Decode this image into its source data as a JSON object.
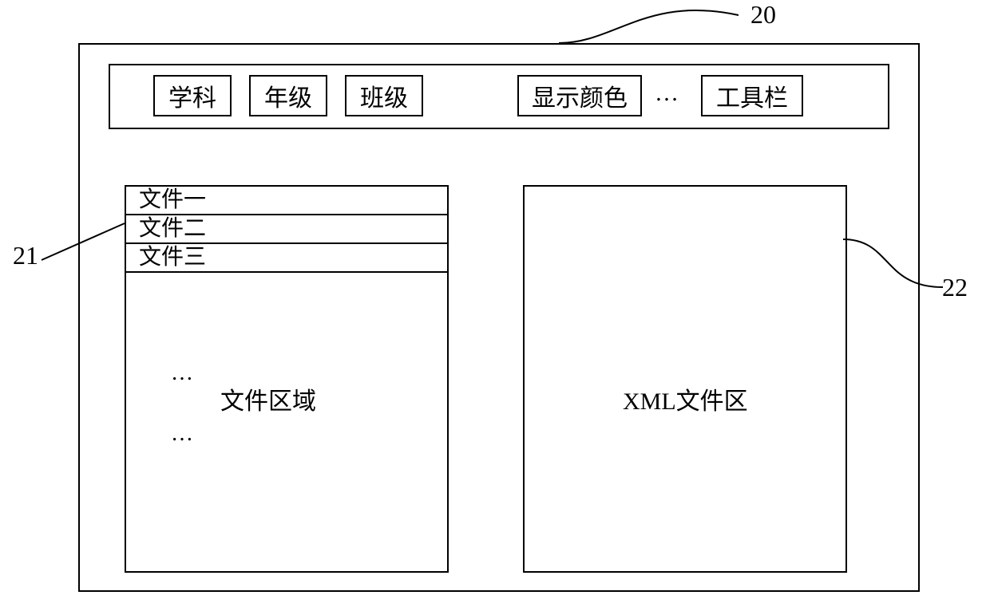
{
  "callouts": {
    "main": "20",
    "file_area": "21",
    "xml_area": "22"
  },
  "toolbar": {
    "subject": "学科",
    "grade": "年级",
    "class": "班级",
    "display_color": "显示颜色",
    "ellipsis": "…",
    "toolbox": "工具栏"
  },
  "file_panel": {
    "items": [
      "文件一",
      "文件二",
      "文件三"
    ],
    "ellipsis_top": "…",
    "area_label": "文件区域",
    "ellipsis_bottom": "…"
  },
  "xml_panel": {
    "label": "XML文件区"
  }
}
